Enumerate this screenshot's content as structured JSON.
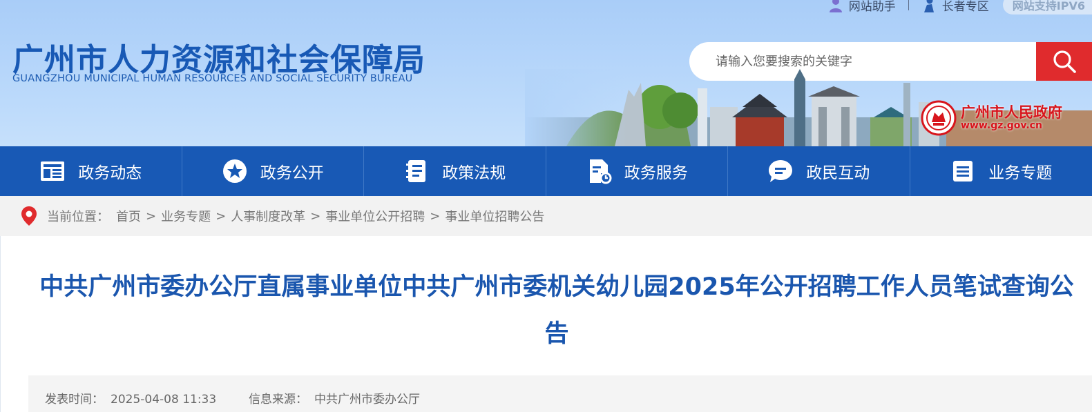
{
  "header": {
    "top_links": [
      {
        "label": "网站助手",
        "icon": "user-icon"
      },
      {
        "label": "长者专区",
        "icon": "elder-icon"
      }
    ],
    "ipv6_badge": "网站支持IPV6",
    "logo_cn": "广州市人力资源和社会保障局",
    "logo_en": "GUANGZHOU MUNICIPAL HUMAN RESOURCES AND SOCIAL SECURITY BUREAU",
    "search": {
      "placeholder": "请输入您要搜索的关键字",
      "button_icon": "search-icon"
    },
    "gz_gov": {
      "name": "广州市人民政府",
      "url": "www.gz.gov.cn"
    }
  },
  "nav": {
    "items": [
      {
        "label": "政务动态",
        "icon": "news-icon"
      },
      {
        "label": "政务公开",
        "icon": "star-icon"
      },
      {
        "label": "政策法规",
        "icon": "book-icon"
      },
      {
        "label": "政务服务",
        "icon": "service-doc-icon"
      },
      {
        "label": "政民互动",
        "icon": "chat-icon"
      },
      {
        "label": "业务专题",
        "icon": "list-icon"
      }
    ]
  },
  "breadcrumb": {
    "label": "当前位置：",
    "items": [
      "首页",
      "业务专题",
      "人事制度改革",
      "事业单位公开招聘",
      "事业单位招聘公告"
    ],
    "separator": ">"
  },
  "article": {
    "title": "中共广州市委办公厅直属事业单位中共广州市委机关幼儿园2025年公开招聘工作人员笔试查询公告",
    "publish_label": "发表时间：",
    "publish_time": "2025-04-08 11:33",
    "source_label": "信息来源：",
    "source": "中共广州市委办公厅"
  },
  "colors": {
    "brand_blue": "#1859b5",
    "title_blue": "#1a56ae",
    "search_red": "#e02b2d",
    "header_bg": "#b3d4f9"
  }
}
